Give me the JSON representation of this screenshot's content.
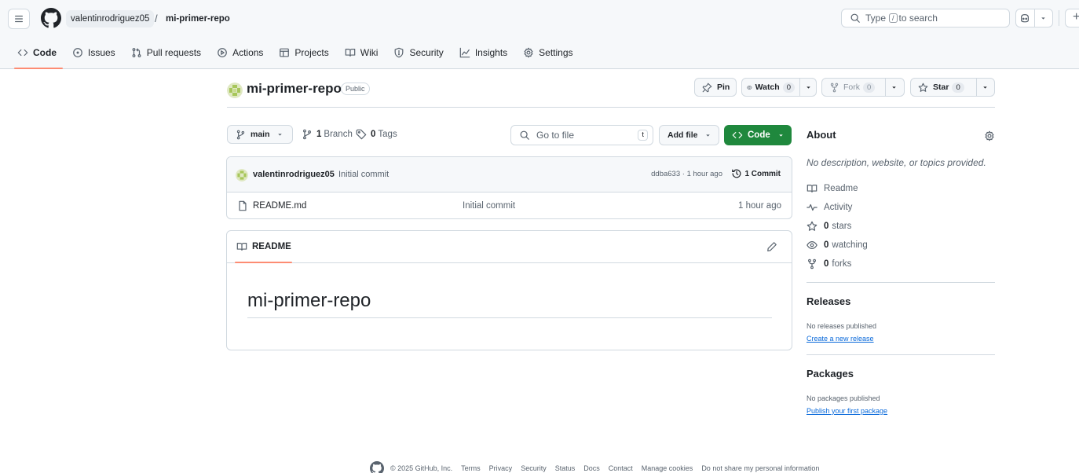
{
  "header": {
    "owner": "valentinrodriguez05",
    "separator": "/",
    "repo": "mi-primer-repo",
    "search_prefix": "Type",
    "search_key": "/",
    "search_suffix": "to search",
    "plus_label": "+"
  },
  "tabs": [
    {
      "label": "Code",
      "icon": "code-icon",
      "active": true
    },
    {
      "label": "Issues",
      "icon": "issue-icon"
    },
    {
      "label": "Pull requests",
      "icon": "pull-request-icon"
    },
    {
      "label": "Actions",
      "icon": "play-icon"
    },
    {
      "label": "Projects",
      "icon": "table-icon"
    },
    {
      "label": "Wiki",
      "icon": "book-icon"
    },
    {
      "label": "Security",
      "icon": "shield-icon"
    },
    {
      "label": "Insights",
      "icon": "graph-icon"
    },
    {
      "label": "Settings",
      "icon": "gear-icon"
    }
  ],
  "repo": {
    "name": "mi-primer-repo",
    "visibility": "Public",
    "pin_label": "Pin",
    "watch_label": "Watch",
    "watch_count": "0",
    "fork_label": "Fork",
    "fork_count": "0",
    "star_label": "Star",
    "star_count": "0"
  },
  "branch_bar": {
    "branch": "main",
    "branch_count": "1",
    "branch_label": "Branch",
    "tag_count": "0",
    "tag_label": "Tags",
    "goto_placeholder": "Go to file",
    "goto_key": "t",
    "add_file_label": "Add file",
    "code_label": "Code"
  },
  "latest_commit": {
    "author": "valentinrodriguez05",
    "message": "Initial commit",
    "hash_time": "ddba633 · 1 hour ago",
    "commit_count_label": "1 Commit"
  },
  "files": [
    {
      "name": "README.md",
      "message": "Initial commit",
      "age": "1 hour ago"
    }
  ],
  "readme": {
    "tab_label": "README",
    "heading": "mi-primer-repo"
  },
  "sidebar": {
    "about_title": "About",
    "about_desc": "No description, website, or topics provided.",
    "readme_link": "Readme",
    "activity_link": "Activity",
    "stars_count": "0",
    "stars_label": "stars",
    "watching_count": "0",
    "watching_label": "watching",
    "forks_count": "0",
    "forks_label": "forks",
    "releases_title": "Releases",
    "releases_none": "No releases published",
    "releases_create": "Create a new release",
    "packages_title": "Packages",
    "packages_none": "No packages published",
    "packages_publish": "Publish your first package"
  },
  "footer": {
    "copyright": "© 2025 GitHub, Inc.",
    "links": [
      "Terms",
      "Privacy",
      "Security",
      "Status",
      "Docs",
      "Contact",
      "Manage cookies",
      "Do not share my personal information"
    ]
  },
  "colors": {
    "accent_green": "#1f883d",
    "tab_underline": "#fd8c73",
    "link_blue": "#0969da"
  }
}
